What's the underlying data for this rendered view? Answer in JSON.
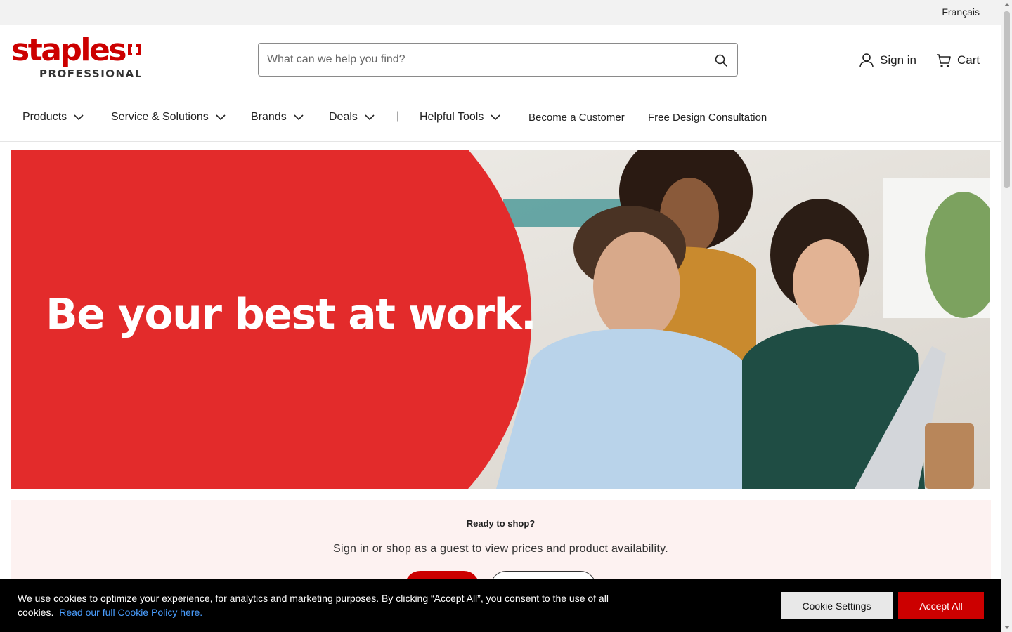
{
  "utility_bar": {
    "language_link": "Français"
  },
  "brand": {
    "wordmark": "staples",
    "subline": "PROFESSIONAL",
    "color": "#cc0000"
  },
  "search": {
    "placeholder": "What can we help you find?",
    "value": "",
    "icon": "search-icon"
  },
  "account": {
    "sign_in_label": "Sign in",
    "icon": "user-icon"
  },
  "cart": {
    "label": "Cart",
    "icon": "cart-icon"
  },
  "nav": {
    "items": [
      {
        "label": "Products",
        "has_dropdown": true
      },
      {
        "label": "Service & Solutions",
        "has_dropdown": true
      },
      {
        "label": "Brands",
        "has_dropdown": true
      },
      {
        "label": "Deals",
        "has_dropdown": true
      },
      {
        "label": "Helpful Tools",
        "has_dropdown": true
      },
      {
        "label": "Become a Customer",
        "has_dropdown": false
      },
      {
        "label": "Free Design Consultation",
        "has_dropdown": false
      }
    ],
    "separator": "|"
  },
  "hero": {
    "headline": "Be your best at work.",
    "accent_color": "#e32b2b"
  },
  "shop_prompt": {
    "title": "Ready to shop?",
    "subtitle": "Sign in or shop as a guest to view prices and product availability.",
    "primary_button": "",
    "secondary_button": ""
  },
  "cookie_banner": {
    "text": "We use cookies to optimize your experience, for analytics and marketing purposes. By clicking “Accept All”, you consent to the use of all cookies.",
    "policy_link": "Read our full Cookie Policy here.",
    "settings_button": "Cookie Settings",
    "accept_button": "Accept All"
  }
}
